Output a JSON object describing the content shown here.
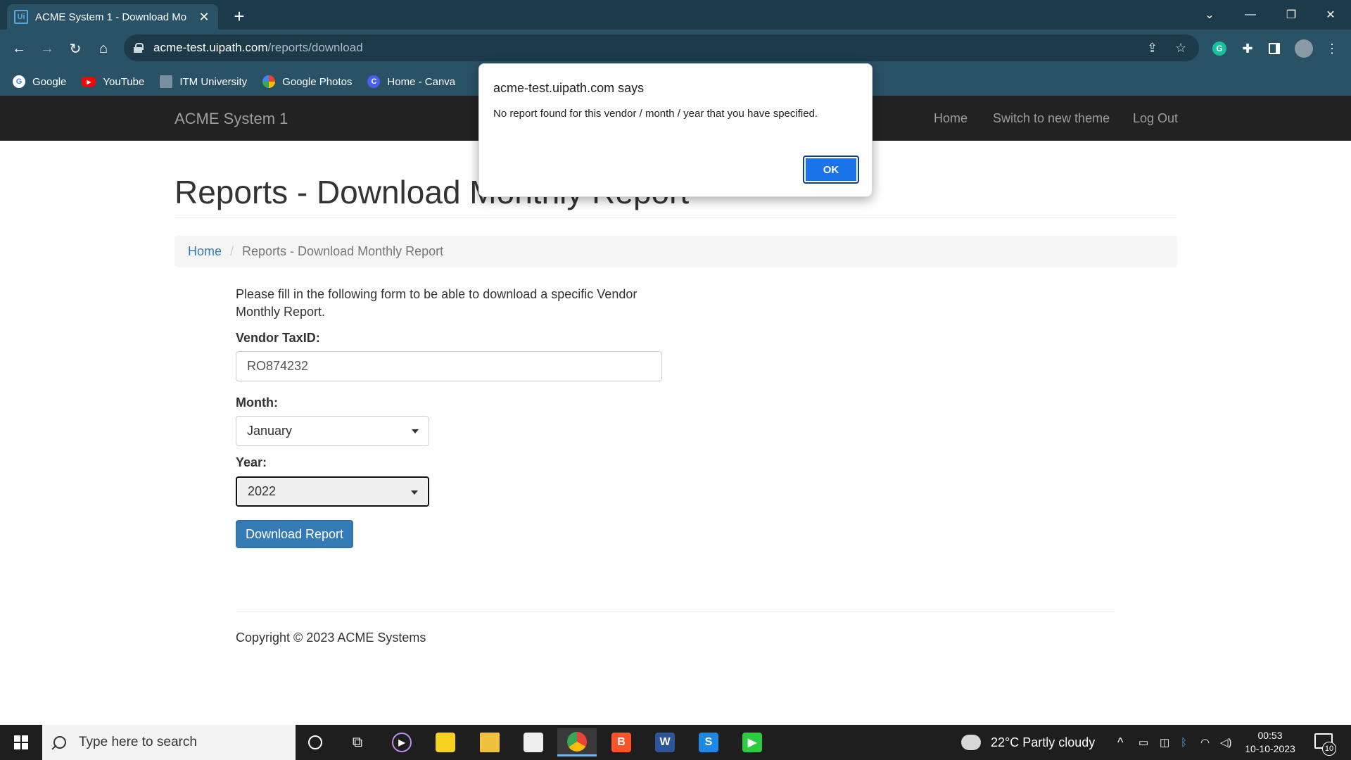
{
  "browser": {
    "tab_title": "ACME System 1 - Download Mo",
    "tab_favicon_text": "Ui",
    "url_host": "acme-test.uipath.com",
    "url_path": "/reports/download",
    "bookmarks": [
      {
        "label": "Google",
        "icon": "google-icon",
        "color": "#4285f4"
      },
      {
        "label": "YouTube",
        "icon": "youtube-icon",
        "color": "#ff0000"
      },
      {
        "label": "ITM University",
        "icon": "itm-icon",
        "color": "#7a8fa0"
      },
      {
        "label": "Google Photos",
        "icon": "photos-icon",
        "color": "#fbbc04"
      },
      {
        "label": "Home - Canva",
        "icon": "canva-icon",
        "color": "#00c4cc"
      }
    ]
  },
  "site": {
    "brand": "ACME System 1",
    "nav": {
      "home": "Home",
      "switch_theme": "Switch to new theme",
      "logout": "Log Out"
    }
  },
  "page": {
    "title": "Reports - Download Monthly Report",
    "breadcrumb": {
      "home": "Home",
      "separator": "/",
      "current": "Reports - Download Monthly Report"
    },
    "intro": "Please fill in the following form to be able to download a specific Vendor Monthly Report.",
    "form": {
      "vendor_label": "Vendor TaxID:",
      "vendor_value": "RO874232",
      "month_label": "Month:",
      "month_value": "January",
      "year_label": "Year:",
      "year_value": "2022",
      "submit_label": "Download Report"
    },
    "footer": "Copyright © 2023 ACME Systems"
  },
  "dialog": {
    "title": "acme-test.uipath.com says",
    "message": "No report found for this vendor / month / year that you have specified.",
    "ok_label": "OK"
  },
  "taskbar": {
    "search_placeholder": "Type here to search",
    "weather": "22°C  Partly cloudy",
    "time": "00:53",
    "date": "10-10-2023",
    "notification_count": "10"
  },
  "colors": {
    "chrome_dark": "#1c3a4a",
    "chrome_light": "#2a5266",
    "navbar": "#222222",
    "link": "#337ab7",
    "primary_button": "#337ab7",
    "dialog_ok": "#1a73e8"
  }
}
